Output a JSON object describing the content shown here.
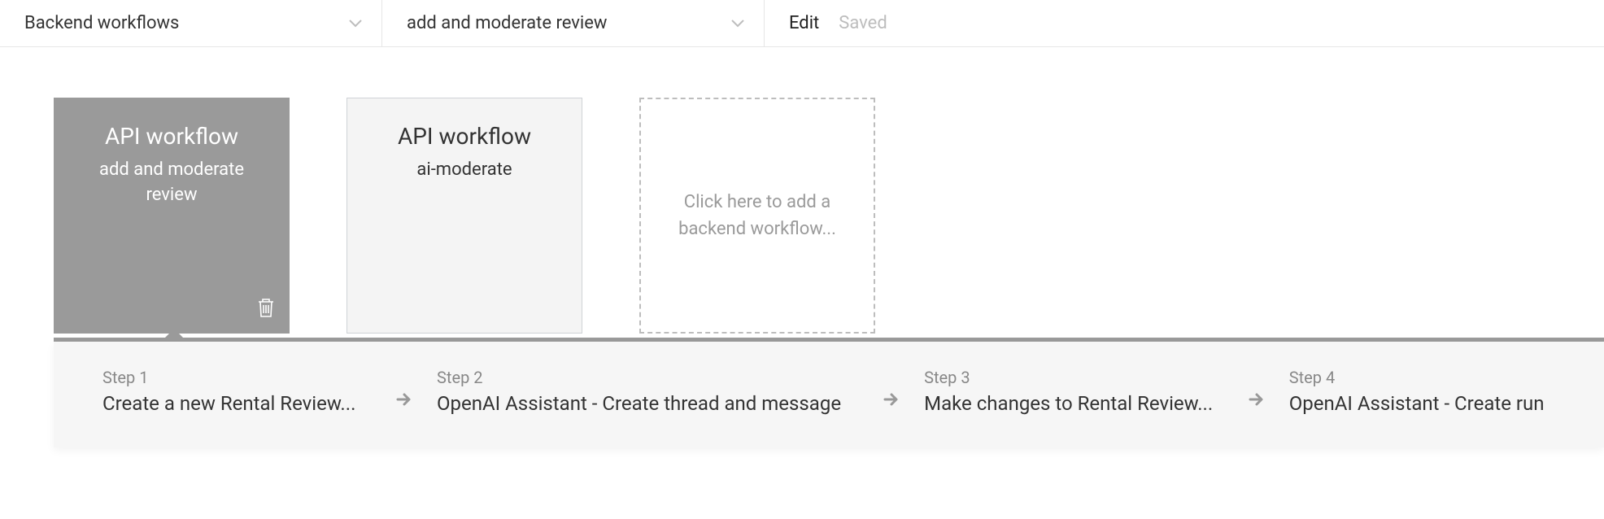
{
  "toolbar": {
    "section_dropdown": "Backend workflows",
    "workflow_dropdown": "add and moderate review",
    "edit_label": "Edit",
    "saved_label": "Saved"
  },
  "workflow_cards": [
    {
      "title": "API workflow",
      "subtitle": "add and moderate review",
      "selected": true
    },
    {
      "title": "API workflow",
      "subtitle": "ai-moderate",
      "selected": false
    }
  ],
  "add_card_text": "Click here to add a backend workflow...",
  "steps": [
    {
      "label": "Step 1",
      "desc": "Create a new Rental Review..."
    },
    {
      "label": "Step 2",
      "desc": "OpenAI Assistant - Create thread and message"
    },
    {
      "label": "Step 3",
      "desc": "Make changes to Rental Review..."
    },
    {
      "label": "Step 4",
      "desc": "OpenAI Assistant - Create run"
    }
  ]
}
